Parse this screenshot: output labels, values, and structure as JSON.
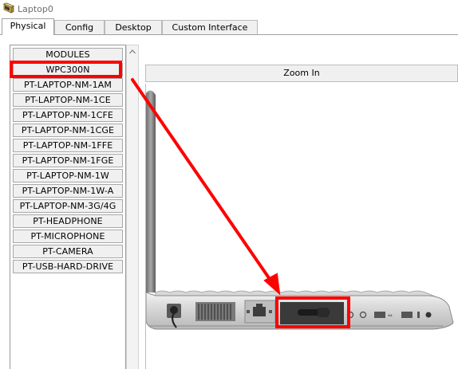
{
  "window": {
    "title": "Laptop0",
    "icon": "laptop-icon"
  },
  "tabs": [
    {
      "label": "Physical",
      "active": true
    },
    {
      "label": "Config",
      "active": false
    },
    {
      "label": "Desktop",
      "active": false
    },
    {
      "label": "Custom Interface",
      "active": false
    }
  ],
  "modules": {
    "header": "MODULES",
    "items": [
      "WPC300N",
      "PT-LAPTOP-NM-1AM",
      "PT-LAPTOP-NM-1CE",
      "PT-LAPTOP-NM-1CFE",
      "PT-LAPTOP-NM-1CGE",
      "PT-LAPTOP-NM-1FFE",
      "PT-LAPTOP-NM-1FGE",
      "PT-LAPTOP-NM-1W",
      "PT-LAPTOP-NM-1W-A",
      "PT-LAPTOP-NM-3G/4G",
      "PT-HEADPHONE",
      "PT-MICROPHONE",
      "PT-CAMERA",
      "PT-USB-HARD-DRIVE"
    ],
    "highlighted": "WPC300N"
  },
  "viewer": {
    "zoom_label": "Zoom In"
  },
  "annotation": {
    "color": "#ff0000",
    "target": "laptop-expansion-slot"
  }
}
